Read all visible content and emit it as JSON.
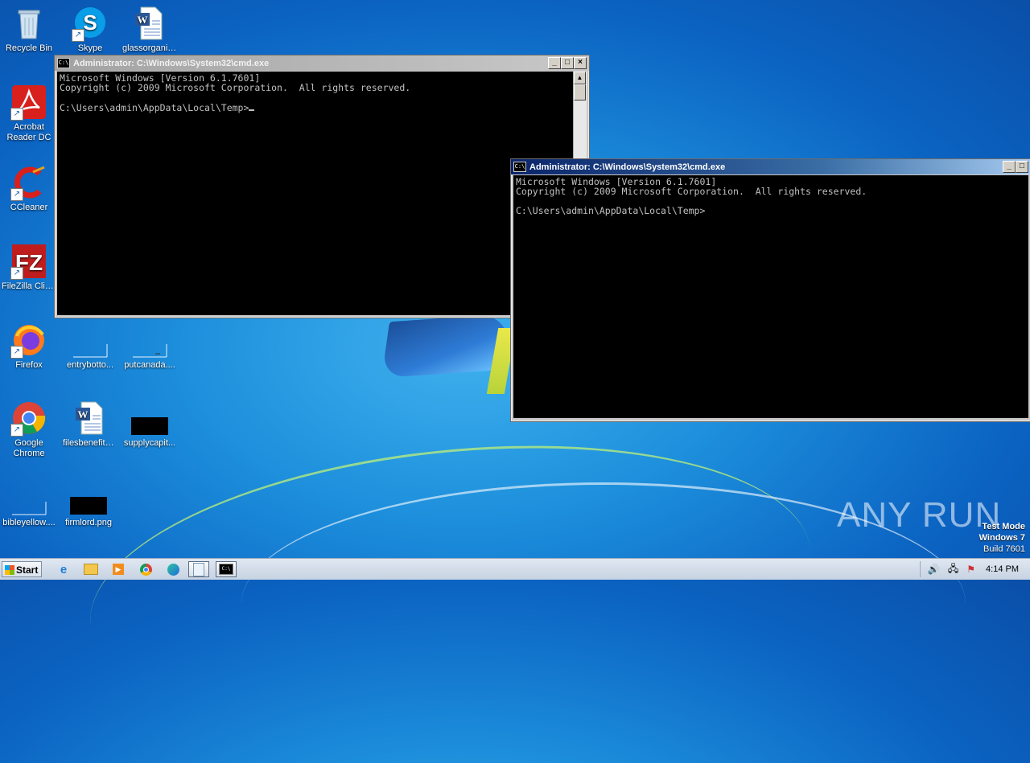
{
  "desktop": {
    "icons": [
      {
        "label": "Recycle Bin",
        "icon": "recycle-bin-icon"
      },
      {
        "label": "Skype",
        "icon": "skype-icon"
      },
      {
        "label": "glassorganiz...",
        "icon": "word-document-icon"
      },
      {
        "label": "Acrobat Reader DC",
        "icon": "acrobat-icon"
      },
      {
        "label": "CCleaner",
        "icon": "ccleaner-icon"
      },
      {
        "label": "FileZilla Client",
        "icon": "filezilla-icon"
      },
      {
        "label": "Firefox",
        "icon": "firefox-icon"
      },
      {
        "label": "entrybotto...",
        "icon": "blank-file-icon"
      },
      {
        "label": "putcanada....",
        "icon": "blank-file-icon"
      },
      {
        "label": "Google Chrome",
        "icon": "chrome-icon"
      },
      {
        "label": "filesbenefits....",
        "icon": "word-document-icon"
      },
      {
        "label": "supplycapit...",
        "icon": "black-image-icon"
      },
      {
        "label": "bibleyellow....",
        "icon": "blank-file-icon"
      },
      {
        "label": "firmlord.png",
        "icon": "black-image-icon"
      }
    ]
  },
  "windows": {
    "back": {
      "title": "Administrator: C:\\Windows\\System32\\cmd.exe",
      "lines": [
        "Microsoft Windows [Version 6.1.7601]",
        "Copyright (c) 2009 Microsoft Corporation.  All rights reserved.",
        "",
        "C:\\Users\\admin\\AppData\\Local\\Temp>"
      ]
    },
    "front": {
      "title": "Administrator: C:\\Windows\\System32\\cmd.exe",
      "lines": [
        "Microsoft Windows [Version 6.1.7601]",
        "Copyright (c) 2009 Microsoft Corporation.  All rights reserved.",
        "",
        "C:\\Users\\admin\\AppData\\Local\\Temp>"
      ]
    }
  },
  "watermark": {
    "brand": "ANY RUN",
    "line1": "Test Mode",
    "line2": "Windows 7",
    "line3": "Build 7601"
  },
  "taskbar": {
    "start_label": "Start",
    "items": [
      "internet-explorer-icon",
      "explorer-folder-icon",
      "media-player-icon",
      "chrome-icon",
      "edge-icon",
      "notepad-icon",
      "cmd-icon"
    ],
    "clock": "4:14 PM"
  }
}
